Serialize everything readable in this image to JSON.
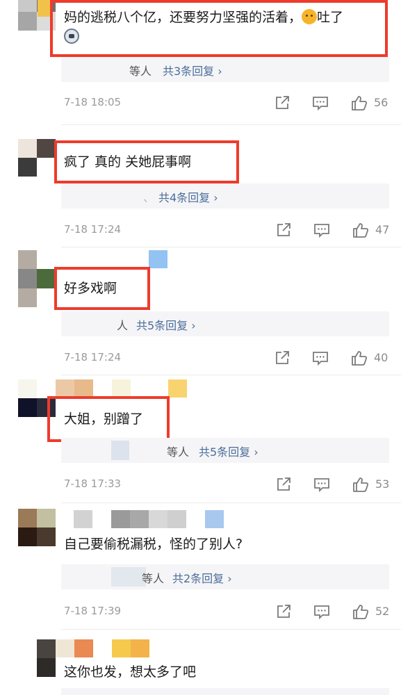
{
  "comments": [
    {
      "text_before": "妈的逃税八个亿，还要努力坚强的活着，",
      "emoji1": "face-emoji",
      "text_after": "吐了",
      "emoji2": "husky-emoji",
      "reply_who": "等人",
      "reply_total": "共3条回复 ›",
      "timestamp": "7-18 18:05",
      "likes": "56"
    },
    {
      "text": "疯了 真的 关她屁事啊",
      "reply_who": "、",
      "reply_total": "共4条回复 ›",
      "timestamp": "7-18 17:24",
      "likes": "47"
    },
    {
      "text": "好多戏啊",
      "reply_who": "人",
      "reply_total": "共5条回复 ›",
      "timestamp": "7-18 17:24",
      "likes": "40"
    },
    {
      "text": "大姐，别蹭了",
      "reply_who": "等人",
      "reply_total": "共5条回复 ›",
      "timestamp": "7-18 17:33",
      "likes": "53"
    },
    {
      "text": "自己要偷税漏税，怪的了别人?",
      "reply_who": "等人",
      "reply_total": "共2条回复 ›",
      "timestamp": "7-18 17:39",
      "likes": "52"
    },
    {
      "text": "这你也发，想太多了吧"
    }
  ],
  "icons": {
    "share": "share-icon",
    "comment": "comment-icon",
    "like": "thumb-up-icon"
  },
  "colors": {
    "highlight": "#ee3b2c",
    "link": "#4b6d9b",
    "meta": "#9a9a9a",
    "reply_bg": "#f5f5f7"
  }
}
